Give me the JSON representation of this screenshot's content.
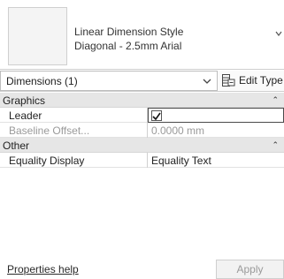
{
  "type_selector": {
    "family_name": "Linear Dimension Style",
    "type_name": "Diagonal - 2.5mm Arial"
  },
  "category_filter": {
    "selected": "Dimensions (1)",
    "edit_type_label": "Edit Type"
  },
  "groups": [
    {
      "label": "Graphics",
      "rows": [
        {
          "name": "Leader",
          "checked": true
        },
        {
          "name": "Baseline Offset...",
          "value": "0.0000 mm",
          "disabled": true
        }
      ]
    },
    {
      "label": "Other",
      "rows": [
        {
          "name": "Equality Display",
          "value": "Equality Text"
        }
      ]
    }
  ],
  "footer": {
    "help_link": "Properties help",
    "apply_label": "Apply"
  },
  "icons": {
    "collapse": "double-chevron-up-icon",
    "dropdown": "chevron-down-icon",
    "edit_type": "edit-type-icon",
    "check": "checkmark-icon"
  }
}
